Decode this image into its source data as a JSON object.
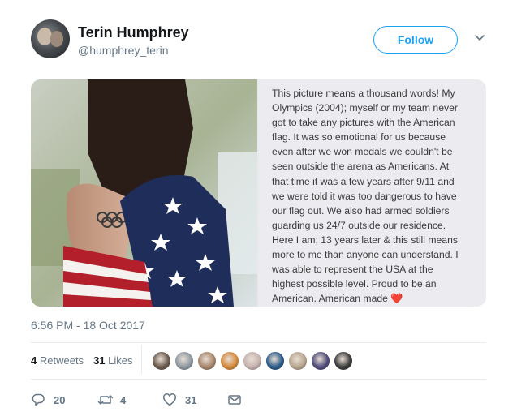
{
  "author": {
    "name": "Terin Humphrey",
    "handle": "@humphrey_terin"
  },
  "follow_label": "Follow",
  "media": {
    "text_lines": [
      "This picture means a thousand words! My",
      "Olympics (2004); myself or my team never",
      "got to take any pictures with the American",
      "flag. It was so emotional for us because",
      "even after we won medals we couldn't be",
      "seen outside the arena as Americans. At",
      "that time it was a few years after 9/11 and",
      "we were told it was too dangerous to have",
      "our flag out. We also had armed soldiers",
      "guarding us 24/7 outside our residence.",
      "Here I am; 13 years later & this still means",
      "more to me than anyone can understand. I",
      "was able to represent the USA at the",
      "highest possible level. Proud to be an",
      "American. American made"
    ],
    "heart_glyph": "❤️"
  },
  "timestamp": "6:56 PM - 18 Oct 2017",
  "stats": {
    "retweets_count": "4",
    "retweets_label": "Retweets",
    "likes_count": "31",
    "likes_label": "Likes"
  },
  "likers": [
    {
      "color": "#6b5a4e"
    },
    {
      "color": "#8e9aa3"
    },
    {
      "color": "#a8866c"
    },
    {
      "color": "#d48a3a"
    },
    {
      "color": "#c7b3b0"
    },
    {
      "color": "#2a5a8a"
    },
    {
      "color": "#b7a690"
    },
    {
      "color": "#4d4b7a"
    },
    {
      "color": "#3b3b3b"
    }
  ],
  "actions": {
    "reply_count": "20",
    "retweet_count": "4",
    "like_count": "31"
  },
  "colors": {
    "accent": "#1da1f2",
    "muted": "#657786",
    "like": "#e0245e"
  }
}
